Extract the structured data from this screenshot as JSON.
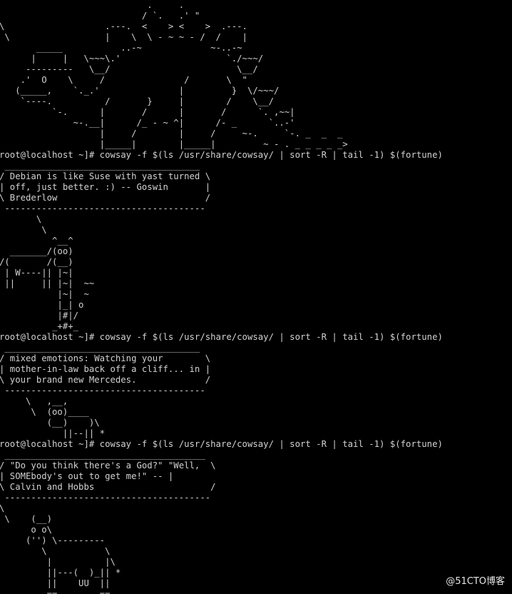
{
  "terminal": {
    "lines": [
      "                            .     .",
      "                           / `.   .' \"",
      "\\                   .---.  <    > <    >  .---.",
      " \\                  |    \\  \\ - ~ ~ - /  /    |",
      "       _____           ..-~             ~-..-~",
      "      |     |   \\~~~\\.'                    `./~~~/",
      "     ---------   \\__/                        \\__/",
      "    .'  O    \\     /               /       \\  \"",
      "   (_____,    `._.'               |         }  \\/~~~/",
      "    `----.          /       }     |        /    \\__/",
      "          `-.      |       /      |       /      `. ,~~|",
      "              ~-.__|      /_ - ~ ^|      /- _      `..-'",
      "                   |     /        |     /     ~-.     `-. _  _  _",
      "                   |_____|        |_____|         ~ - . _ _ _ _ _>",
      "root@localhost ~]# cowsay -f $(ls /usr/share/cowsay/ | sort -R | tail -1) $(fortune)",
      " _____________________________________",
      "/ Debian is like Suse with yast turned \\",
      "| off, just better. :) -- Goswin       |",
      "\\ Brederlow                            /",
      " --------------------------------------",
      "       \\",
      "        \\",
      "          ^__^",
      "  _______/(oo)",
      "/(       /(__)",
      " | W----|| |~|",
      " ||     || |~|  ~~",
      "           |~|  ~",
      "           |_| o",
      "           |#|/",
      "          _+#+_",
      "root@localhost ~]# cowsay -f $(ls /usr/share/cowsay/ | sort -R | tail -1) $(fortune)",
      " _____________________________________",
      "/ mixed emotions: Watching your        \\",
      "| mother-in-law back off a cliff... in |",
      "\\ your brand new Mercedes.             /",
      " --------------------------------------",
      "     \\   ,__,",
      "      \\  (oo)____",
      "         (__)    )\\",
      "            ||--|| *",
      "root@localhost ~]# cowsay -f $(ls /usr/share/cowsay/ | sort -R | tail -1) $(fortune)",
      " ______________________________________",
      "/ \"Do you think there's a God?\" \"Well,  \\",
      "| SOMEbody's out to get me!\" -- |",
      "\\ Calvin and Hobbs                      /",
      " ---------------------------------------",
      "\\",
      " \\    (__)",
      "      o o\\",
      "     ('') \\---------",
      "        \\           \\",
      "         |          |\\",
      "         ||---(  )_|| *",
      "         ||    UU  ||",
      "         ==        =="
    ]
  },
  "watermark": {
    "text": "@51CTO博客"
  }
}
